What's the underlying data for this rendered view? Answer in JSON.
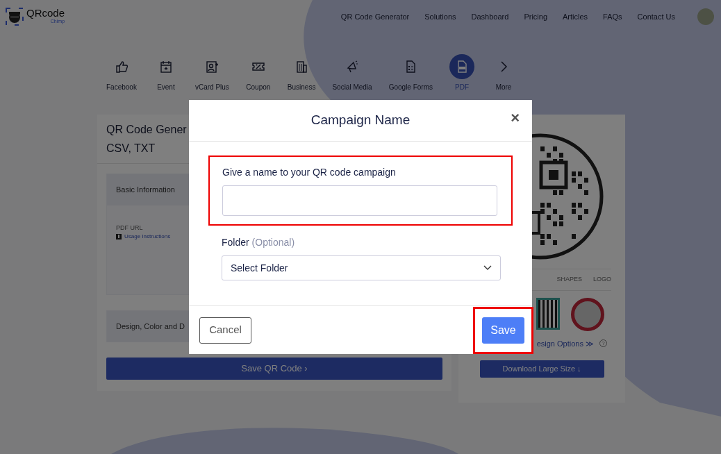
{
  "logo": {
    "title": "QRcode",
    "subtitle": "Chimp"
  },
  "nav": [
    "QR Code Generator",
    "Solutions",
    "Dashboard",
    "Pricing",
    "Articles",
    "FAQs",
    "Contact Us"
  ],
  "categories": [
    {
      "label": "Facebook",
      "selected": false
    },
    {
      "label": "Event",
      "selected": false
    },
    {
      "label": "vCard Plus",
      "selected": false
    },
    {
      "label": "Coupon",
      "selected": false
    },
    {
      "label": "Business",
      "selected": false
    },
    {
      "label": "Social Media",
      "selected": false
    },
    {
      "label": "Google Forms",
      "selected": false
    },
    {
      "label": "PDF",
      "selected": true
    },
    {
      "label": "More",
      "selected": false
    }
  ],
  "form_card": {
    "title_lines": [
      "QR Code Gener",
      "CSV, TXT"
    ],
    "sections": [
      {
        "title": "Basic Information",
        "field_label": "PDF URL",
        "help_link": "Usage Instructions"
      },
      {
        "title": "Design, Color and D"
      }
    ],
    "save_button": "Save QR Code ›"
  },
  "preview_card": {
    "tabs": [
      "SHAPES",
      "LOGO"
    ],
    "options_link": "esign Options ≫",
    "help": "?",
    "download_button": "Download Large Size ↓"
  },
  "modal": {
    "title": "Campaign Name",
    "close": "×",
    "name_label": "Give a name to your QR code campaign",
    "name_highlighted": true,
    "folder_label": "Folder",
    "folder_hint": "(Optional)",
    "folder_value": "Select Folder",
    "cancel": "Cancel",
    "save": "Save",
    "save_highlighted": true
  }
}
